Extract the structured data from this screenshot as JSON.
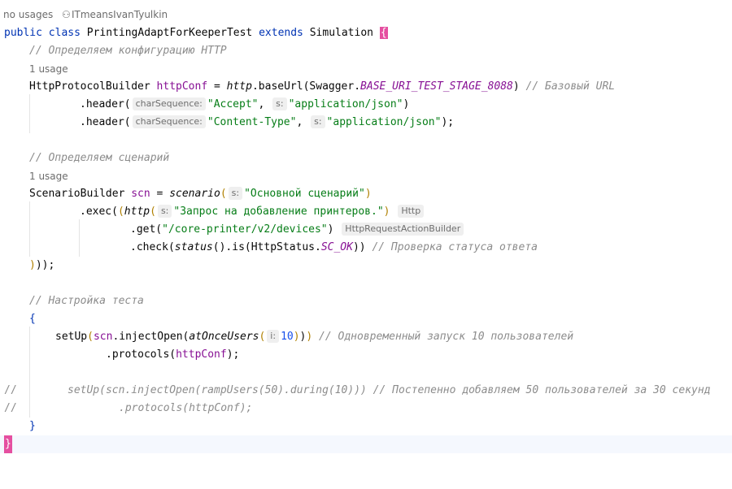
{
  "header": {
    "usages": "no usages",
    "author": "ITmeansIvanTyulkin"
  },
  "code": {
    "l_class_public": "public",
    "l_class_class": "class",
    "l_class_name": "PrintingAdaptForKeeperTest",
    "l_class_extends": "extends",
    "l_class_super": "Simulation",
    "l_class_brace": "{",
    "c_http_config": "// Определяем конфигурацию HTTP",
    "usage1": "1 usage",
    "http_type": "HttpProtocolBuilder",
    "http_var": "httpConf",
    "eq": " = ",
    "http_fn": "http",
    "base_url_call": ".baseUrl(",
    "swagger": "Swagger.",
    "base_uri_const": "BASE_URI_TEST_STAGE_8088",
    "base_url_close": ")",
    "c_base_url": "// Базовый URL",
    "header_call": ".header(",
    "hint_charseq": "charSequence:",
    "hint_s": "s:",
    "str_accept": "\"Accept\"",
    "str_app_json": "\"application/json\"",
    "str_content_type": "\"Content-Type\"",
    "c_scenario": "// Определяем сценарий",
    "usage2": "1 usage",
    "scn_type": "ScenarioBuilder",
    "scn_var": "scn",
    "scn_fn": "scenario",
    "str_scn_name": "\"Основной сценарий\"",
    "exec_call": ".exec(",
    "http_req_fn": "http",
    "str_req_name": "\"Запрос на добавление принтеров.\"",
    "hint_http": "Http",
    "get_call": ".get(",
    "str_devices": "\"/core-printer/v2/devices\"",
    "hint_builder": "HttpRequestActionBuilder",
    "check_call": ".check(",
    "status_fn": "status",
    "is_call": ".is(",
    "http_status": "HttpStatus.",
    "sc_ok": "SC_OK",
    "c_status": "// Проверка статуса ответа",
    "close_scn": "));",
    "c_test_setup": "// Настройка теста",
    "open_brace": "{",
    "setup_fn": "setUp",
    "inject_open": ".injectOpen(",
    "at_once_fn": "atOnceUsers",
    "hint_i": "i:",
    "num_10": "10",
    "c_at_once": "// Одновременный запуск 10 пользователей",
    "protocols_call": ".protocols(",
    "commented_setup": "setUp(scn.injectOpen(rampUsers(50).during(10))) // Постепенно добавляем 50 пользователей за 30 секунд",
    "commented_protocols": ".protocols(httpConf);",
    "comment_slashes": "//",
    "close_brace": "}",
    "final_brace": "}"
  }
}
